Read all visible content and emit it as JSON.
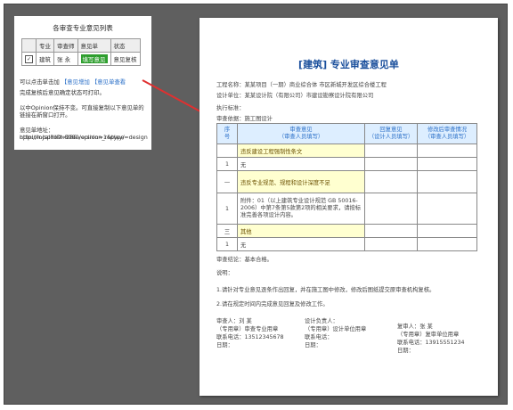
{
  "panel": {
    "title": "各审查专业意见列表",
    "headers": [
      "",
      "专业",
      "审查师",
      "意见单",
      "状态"
    ],
    "row": {
      "checked": "✓",
      "major": "建筑",
      "reviewer": "张 永",
      "action": "填写意见",
      "status": "意见复核"
    },
    "info1_prefix": "可以点击单击加",
    "info1_link1": "【意见增加",
    "info1_link2": "【意见单查看",
    "info2": "完成复核后意见确定状态可打印。",
    "info3": "以中Opinion保持不变。可直接复制以下意见单的",
    "info4": "链接在新窗口打开。",
    "url_label": "意见单地址：http://localhost:8080/opinion_replay/",
    "url_line2": "opinion.jsp?iID=28&version=1&type=design"
  },
  "doc": {
    "title": "[建筑] 专业审查意见单",
    "line1": "工程名称：某某项目（一期）商业综合体 市区新城开发区综合楼工程",
    "line2": "设计单位：某某设计院（有限公司）市建设勘察设计院有限公司",
    "line3": "执行标准：",
    "line4": "审查依据：施工图设计",
    "table": {
      "headers": [
        {
          "num": "序\n号",
          "text": "审查意见\n（审查人员填写）"
        },
        {
          "text": "回复意见\n（设计人员填写）"
        },
        {
          "text": "修改后审查情况\n（审查人员填写）"
        }
      ],
      "rows": [
        {
          "type": "section",
          "text": "违反建设工程强制性条文"
        },
        {
          "num": "1",
          "text": "无"
        },
        {
          "type": "section",
          "num": "一",
          "text": "违反专业规范、规程和设计深度不足"
        },
        {
          "num": "1",
          "text": "附件：01（以上建筑专业设计规范 GB 50016-2006）中第7条第5款第2项的相关要求，请按标准完善各项设计内容。"
        },
        {
          "type": "section",
          "num": "三",
          "text": "其他"
        },
        {
          "num": "1",
          "text": "无"
        }
      ]
    },
    "note1": "审查结论：基本合格。",
    "note2": "说明：",
    "note3": "1.请针对专业意见逐条作出回复，并在施工图中修改，修改后图纸提交原审查机构复核。",
    "note4": "2.请在规定时间内完成意见回复及修改工作。",
    "sig": {
      "reviewer_label": "审查人：",
      "reviewer_name": "刘 某",
      "reviewer_seal": "（专用章）审查专业用章",
      "date_label1": "日期：",
      "phone_label": "联系电话：",
      "phone": "13512345678",
      "designer_label": "设计负责人：",
      "designer_seal": "（专用章）设计单位用章",
      "contact_label": "联系电话：",
      "date_label2": "日期：",
      "owner_label": "复审人：",
      "owner_name": "张 某",
      "owner_seal": "（专用章）复审单位用章",
      "owner_phone_label": "联系电话：",
      "owner_phone": "13915551234",
      "owner_date": "日期："
    }
  },
  "colors": {
    "frame": "#5f5f5f",
    "title": "#1a4f9c",
    "link": "#2a6fc8",
    "badge": "#2e9e2e",
    "arrow": "#e03030"
  }
}
